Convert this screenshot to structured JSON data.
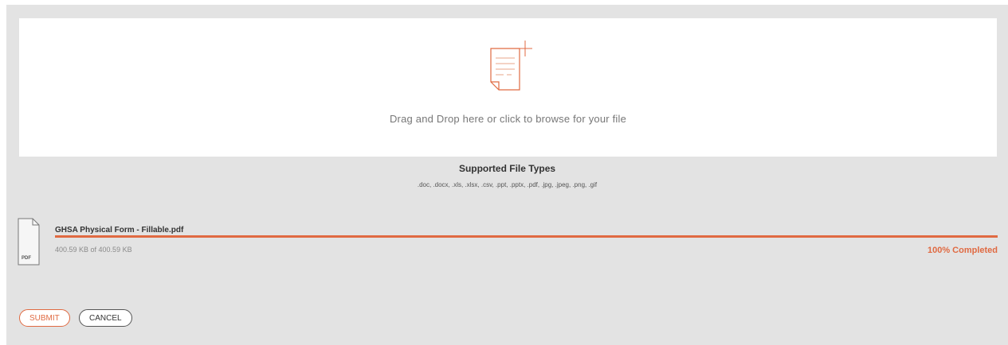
{
  "dropzone": {
    "icon": "document-add-icon",
    "text": "Drag and Drop here or click to browse for your file"
  },
  "supported": {
    "title": "Supported File Types",
    "types": ".doc, .docx, .xls, .xlsx, .csv, .ppt, .pptx, .pdf, .jpg, .jpeg, .png, .gif"
  },
  "file": {
    "icon": "pdf-file-icon",
    "icon_label": "PDF",
    "name": "GHSA Physical Form - Fillable.pdf",
    "size_text": "400.59 KB of 400.59 KB",
    "progress_percent": 100,
    "status": "100% Completed"
  },
  "actions": {
    "submit_label": "SUBMIT",
    "cancel_label": "CANCEL"
  },
  "colors": {
    "accent": "#e06a42",
    "panel_background": "#e3e3e3",
    "dropzone_background": "#ffffff"
  }
}
